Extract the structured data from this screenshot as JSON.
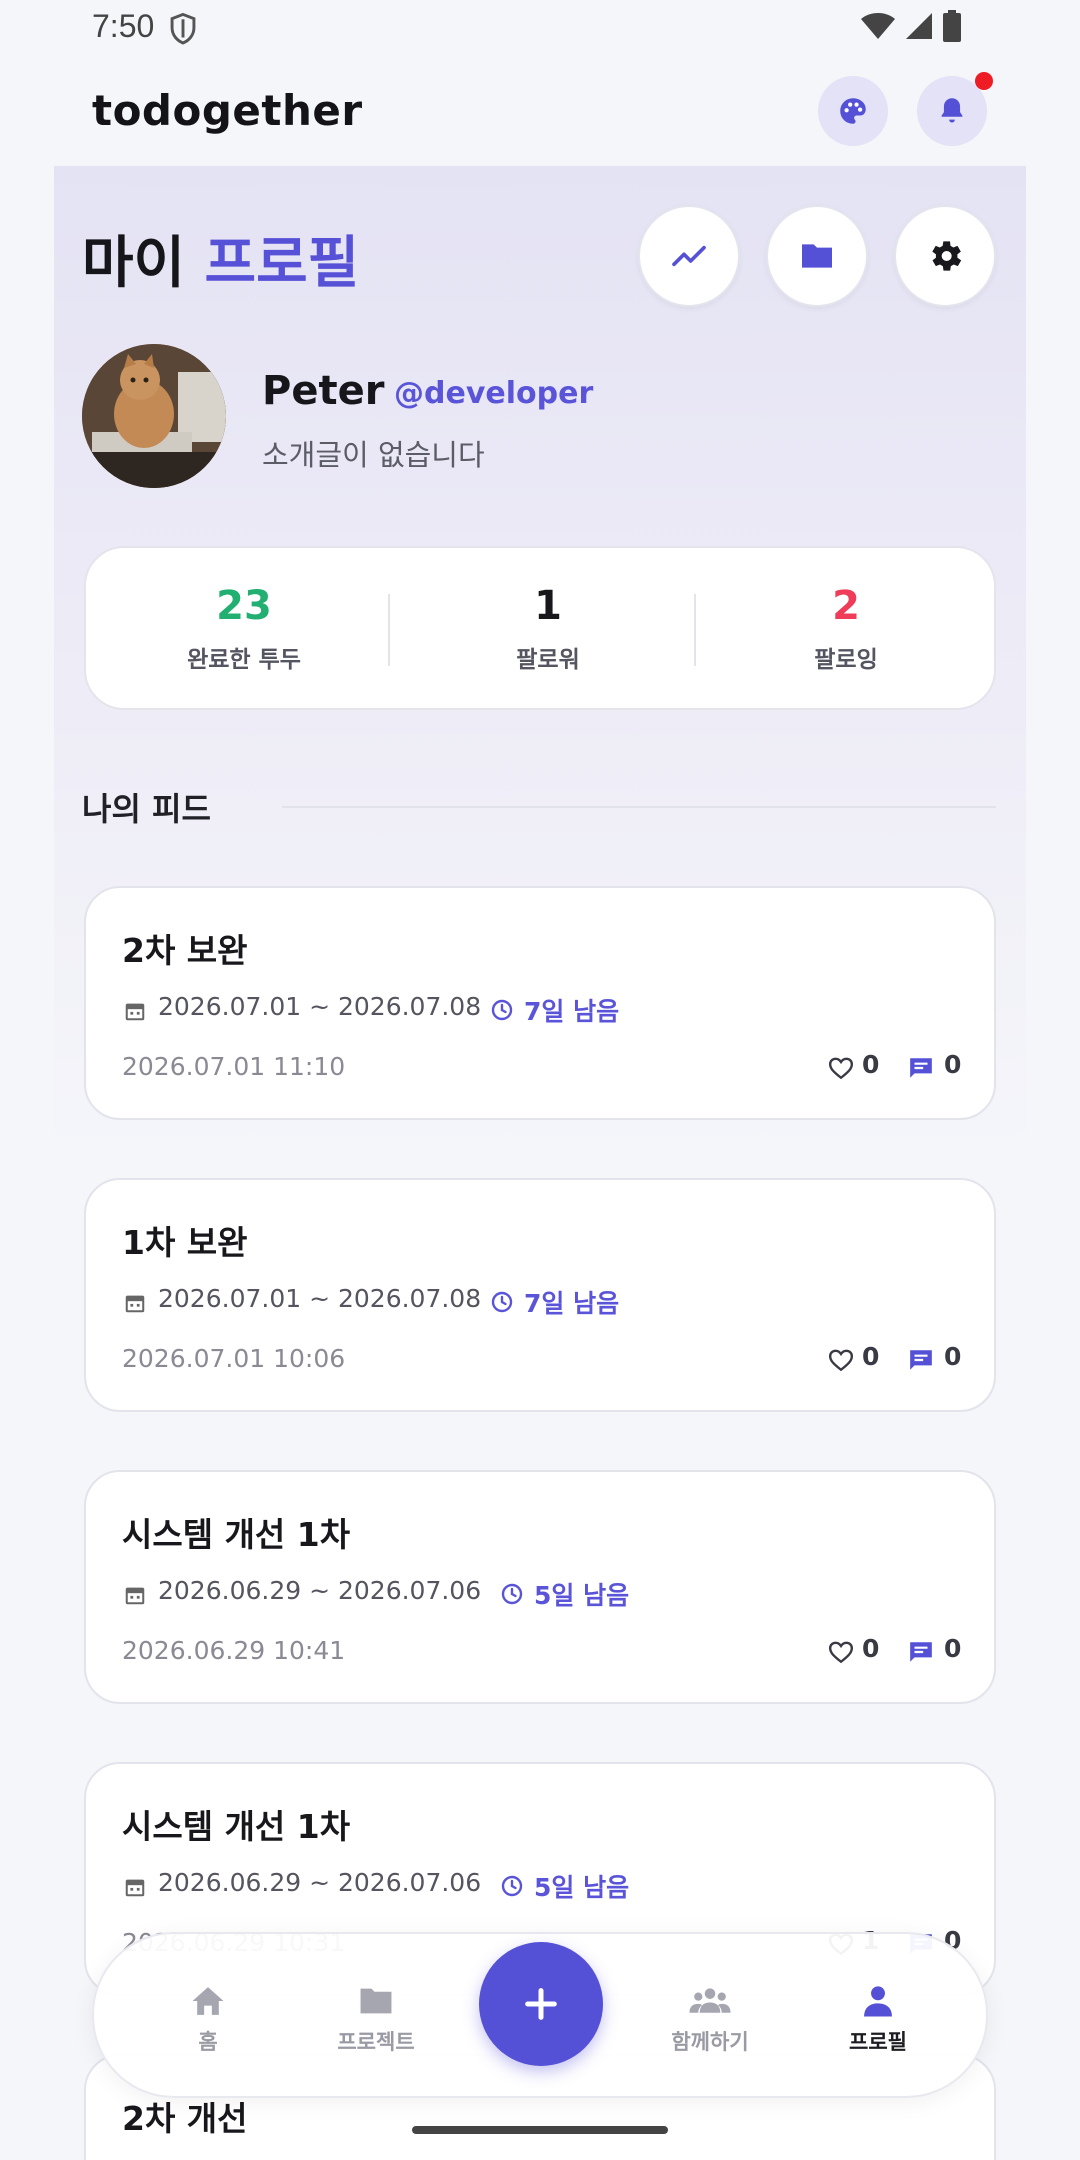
{
  "status_bar": {
    "time": "7:50"
  },
  "header": {
    "brand": "todogether"
  },
  "profile": {
    "title_prefix": "마이",
    "title_accent": "프로필",
    "name": "Peter",
    "handle": "@developer",
    "bio": "소개글이 없습니다"
  },
  "stats": [
    {
      "value": "23",
      "label": "완료한 투두",
      "color": "#21b072"
    },
    {
      "value": "1",
      "label": "팔로워",
      "color": "#17171c"
    },
    {
      "value": "2",
      "label": "팔로잉",
      "color": "#ef3c58"
    }
  ],
  "feed": {
    "section_title": "나의 피드",
    "items": [
      {
        "title": "2차 보완",
        "range": "2026.07.01 ~ 2026.07.08",
        "remaining": "7일 남음",
        "created": "2026.07.01 11:10",
        "likes": "0",
        "comments": "0"
      },
      {
        "title": "1차 보완",
        "range": "2026.07.01 ~ 2026.07.08",
        "remaining": "7일 남음",
        "created": "2026.07.01 10:06",
        "likes": "0",
        "comments": "0"
      },
      {
        "title": "시스템 개선 1차",
        "range": "2026.06.29 ~ 2026.07.06",
        "remaining": "5일 남음",
        "created": "2026.06.29 10:41",
        "likes": "0",
        "comments": "0"
      },
      {
        "title": "시스템 개선 1차",
        "range": "2026.06.29 ~ 2026.07.06",
        "remaining": "5일 남음",
        "created": "2026.06.29 10:31",
        "likes": "1",
        "comments": "0"
      },
      {
        "title": "2차 개선"
      }
    ]
  },
  "nav": {
    "items": [
      {
        "label": "홈",
        "icon": "home-icon"
      },
      {
        "label": "프로젝트",
        "icon": "folder-icon"
      },
      {
        "label": "함께하기",
        "icon": "group-icon"
      },
      {
        "label": "프로필",
        "icon": "person-icon",
        "active": true
      }
    ],
    "fab_icon": "plus-icon"
  },
  "colors": {
    "accent": "#5551d6",
    "completed": "#21b072",
    "following": "#ef3c58",
    "notification": "#ee1c25"
  }
}
